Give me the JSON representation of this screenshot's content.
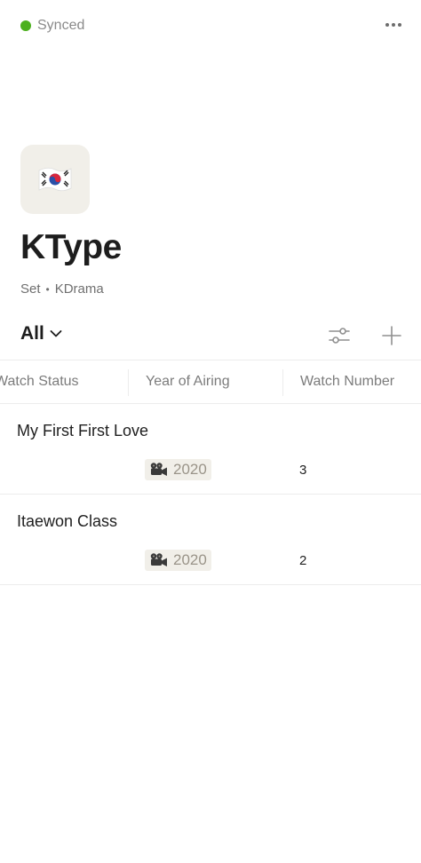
{
  "status": {
    "label": "Synced",
    "color": "#4cb01e"
  },
  "menu_icon": "more-horizontal-icon",
  "page": {
    "icon": "south-korea-flag-icon",
    "title": "KType",
    "breadcrumb": [
      "Set",
      "KDrama"
    ]
  },
  "view": {
    "label": "All",
    "filter_icon": "sliders-icon",
    "add_icon": "plus-icon"
  },
  "columns": [
    "Watch Status",
    "Year of Airing",
    "Watch Number"
  ],
  "rows": [
    {
      "title": "My First First Love",
      "watch_status": "",
      "year": "2020",
      "year_icon": "movie-camera-icon",
      "watch_number": "3"
    },
    {
      "title": "Itaewon Class",
      "watch_status": "",
      "year": "2020",
      "year_icon": "movie-camera-icon",
      "watch_number": "2"
    }
  ]
}
